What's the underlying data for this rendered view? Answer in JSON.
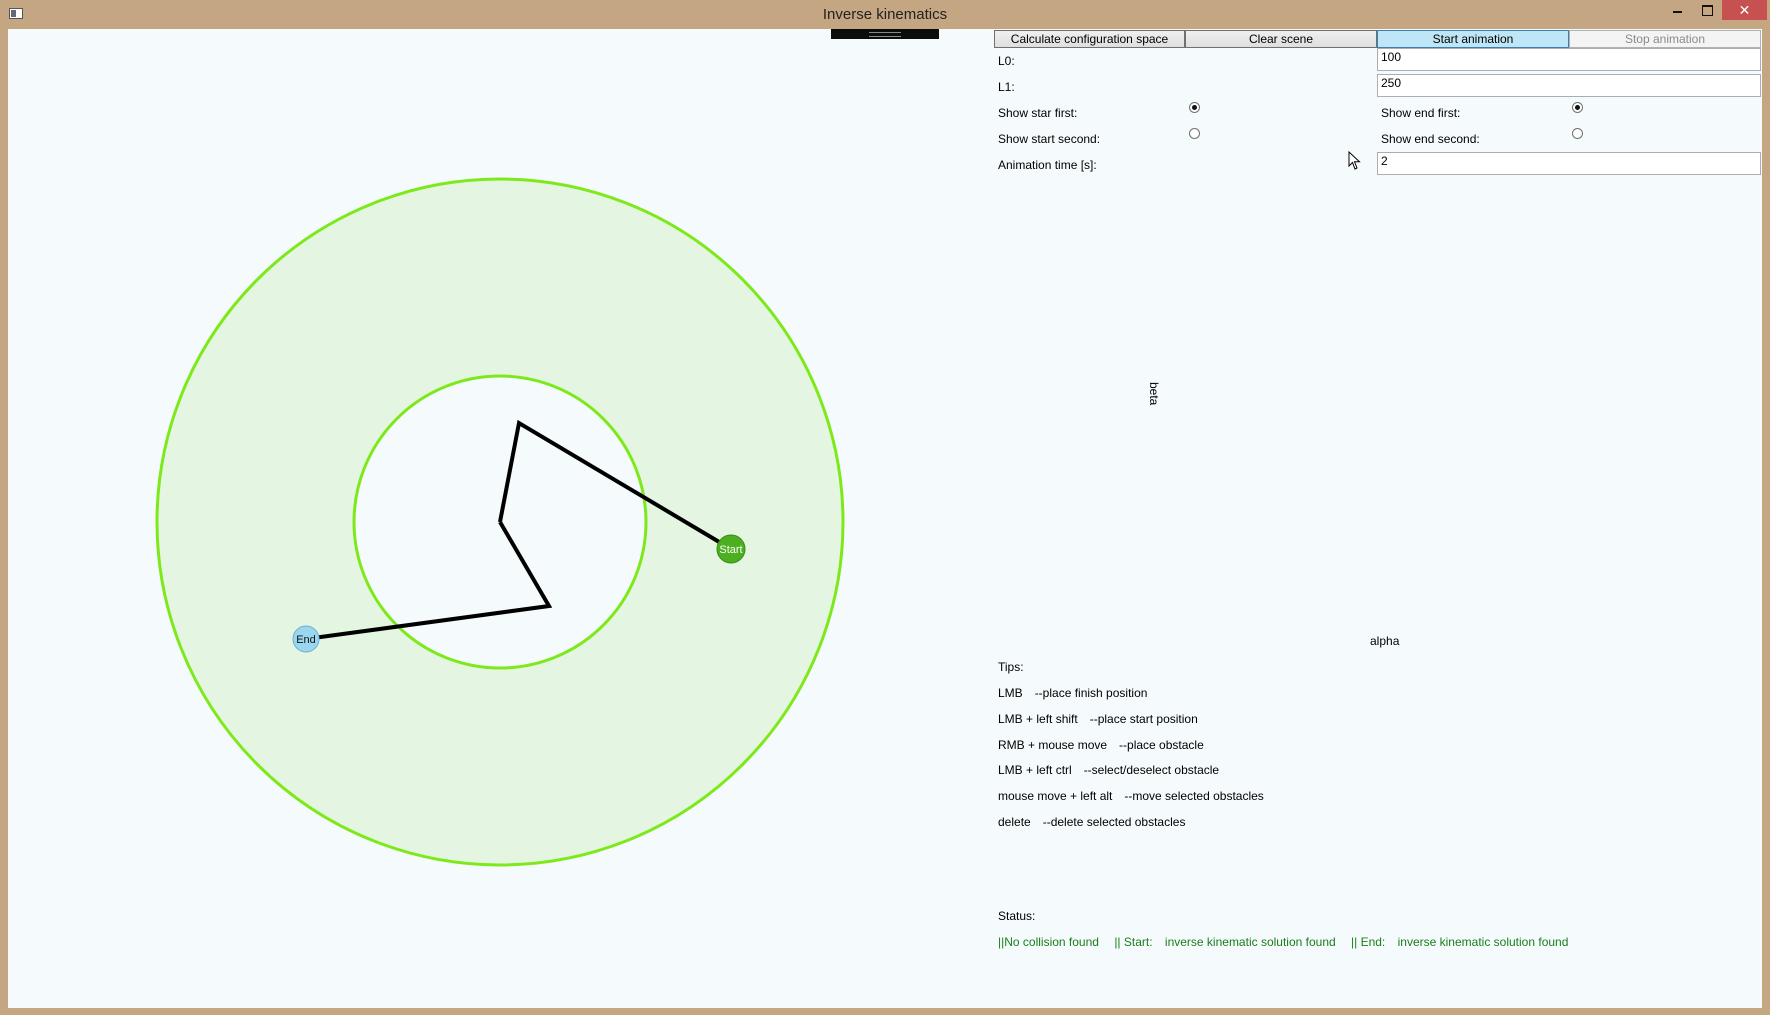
{
  "window": {
    "title": "Inverse kinematics",
    "minimize_icon": "minimize-icon",
    "maximize_icon": "maximize-icon",
    "close_icon": "close-icon",
    "close_glyph": "✕",
    "accent_close": "#c75050"
  },
  "scene": {
    "start_marker_label": "Start",
    "finish_marker_label": "End",
    "workspace_fill": "#e4f6e2",
    "workspace_stroke": "#7ee91a",
    "arm_color": "#000000",
    "start_color": "#4caf20",
    "finish_color": "#9ad6f0"
  },
  "toolbar": {
    "calc_label": "Calculate configuration space",
    "clear_label": "Clear scene",
    "start_label": "Start animation",
    "stop_label": "Stop animation"
  },
  "params": {
    "l0_label": "L0:",
    "l0_value": "100",
    "l1_label": "L1:",
    "l1_value": "250",
    "show_star_first_label": "Show star first:",
    "show_start_second_label": "Show start second:",
    "show_end_first_label": "Show end first:",
    "show_end_second_label": "Show end second:",
    "animation_time_label": "Animation time [s]:",
    "animation_time_value": "2",
    "show_start_first_checked": true,
    "show_end_first_checked": true
  },
  "config_space": {
    "beta_label": "beta",
    "alpha_label": "alpha"
  },
  "tips": {
    "heading": "Tips:",
    "items": [
      {
        "key": "LMB",
        "desc": "--place finish position"
      },
      {
        "key": "LMB + left shift",
        "desc": "--place start position"
      },
      {
        "key": "RMB + mouse move",
        "desc": "--place obstacle"
      },
      {
        "key": "LMB + left ctrl",
        "desc": "--select/deselect obstacle"
      },
      {
        "key": "mouse move + left alt",
        "desc": "--move selected obstacles"
      },
      {
        "key": "delete",
        "desc": "--delete selected obstacles"
      }
    ]
  },
  "status": {
    "heading": "Status:",
    "collision": "||No collision found",
    "start_label": "|| Start:",
    "start_text": "inverse kinematic solution found",
    "end_label": "|| End:",
    "end_text": "inverse kinematic solution found",
    "color": "#1a7d1a"
  }
}
